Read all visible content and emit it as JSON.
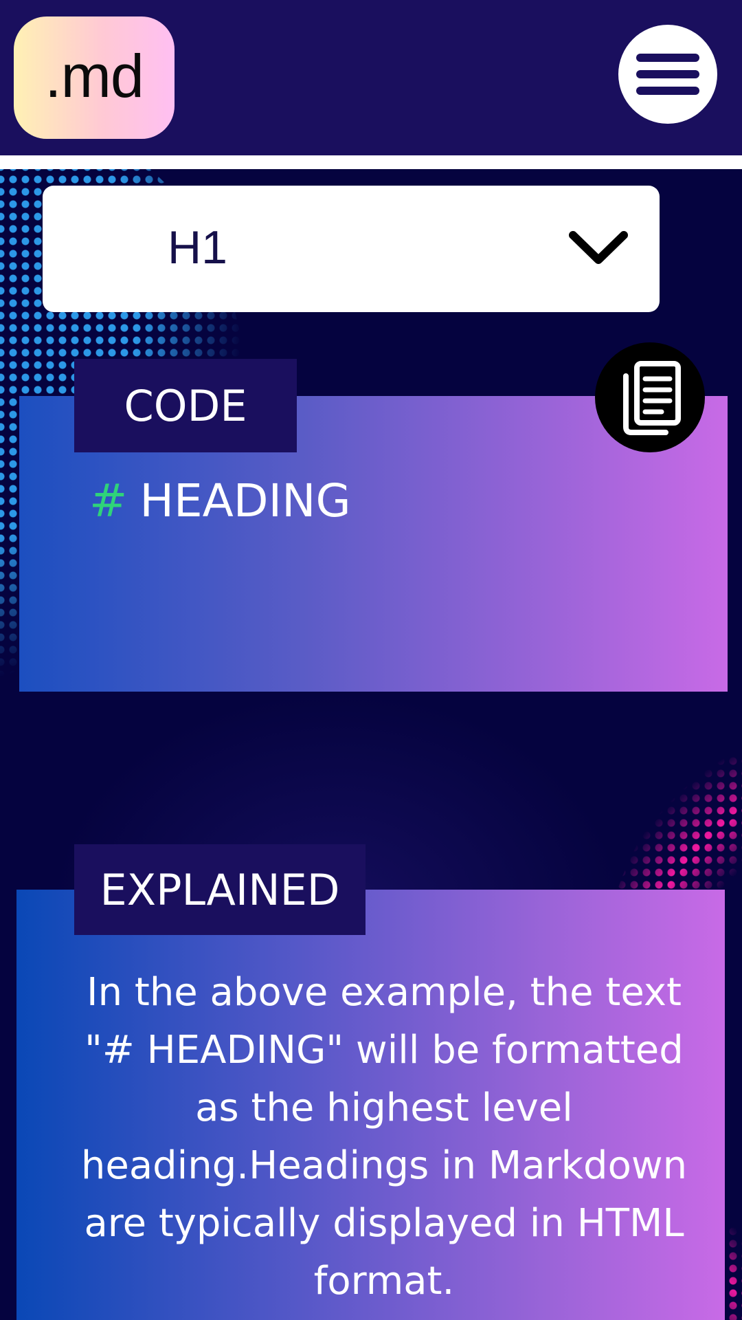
{
  "header": {
    "logo_text": ".md",
    "menu_icon": "hamburger-menu-icon"
  },
  "selector": {
    "value": "H1",
    "chevron_icon": "chevron-down-icon"
  },
  "code_section": {
    "label": "CODE",
    "hash": "#",
    "code_text": "HEADING",
    "copy_icon": "copy-document-icon",
    "hash_color": "#2fd37a"
  },
  "explained_section": {
    "label": "EXPLAINED",
    "text": "In the above example, the text \"# HEADING\" will be formatted as the highest level heading.Headings in Markdown are typically displayed in HTML format."
  },
  "colors": {
    "header_bg": "#1a0f5e",
    "page_bg": "#05033f",
    "label_bg": "#1a0f5e",
    "card_gradient_start": "#1c4fc0",
    "card_gradient_end": "#c86ae6"
  }
}
